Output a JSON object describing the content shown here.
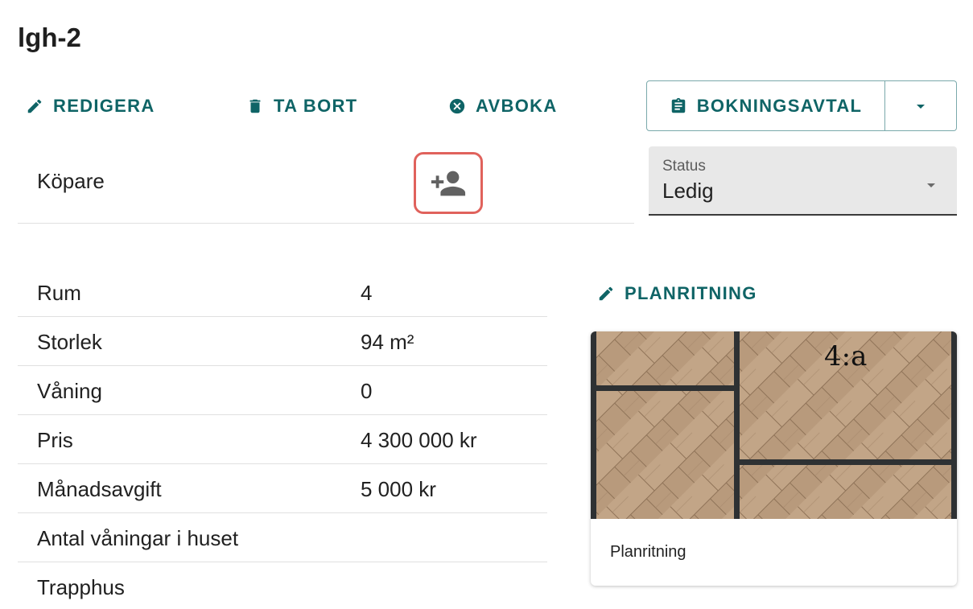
{
  "header": {
    "title": "lgh-2"
  },
  "actions": {
    "edit_label": "REDIGERA",
    "delete_label": "TA BORT",
    "cancel_booking_label": "AVBOKA",
    "booking_agreement_label": "BOKNINGSAVTAL"
  },
  "buyer": {
    "label": "Köpare"
  },
  "status": {
    "label": "Status",
    "value": "Ledig"
  },
  "properties": [
    {
      "label": "Rum",
      "value": "4"
    },
    {
      "label": "Storlek",
      "value": "94 m²"
    },
    {
      "label": "Våning",
      "value": "0"
    },
    {
      "label": "Pris",
      "value": "4 300 000 kr"
    },
    {
      "label": "Månadsavgift",
      "value": "5 000 kr"
    },
    {
      "label": "Antal våningar i huset",
      "value": ""
    },
    {
      "label": "Trapphus",
      "value": ""
    }
  ],
  "floorplan": {
    "link_label": "PLANRITNING",
    "room_label": "4:a",
    "caption": "Planritning"
  },
  "colors": {
    "accent": "#0f6466",
    "highlight_border": "#e0625c",
    "select_background": "#e8e8e8",
    "wall": "#2e3133",
    "floor": "#b8997a"
  },
  "icons": {
    "edit": "pencil-icon",
    "delete": "trash-icon",
    "cancel": "cancel-circle-icon",
    "agreement": "clipboard-icon",
    "dropdown": "caret-down-icon",
    "add_buyer": "add-person-icon"
  }
}
